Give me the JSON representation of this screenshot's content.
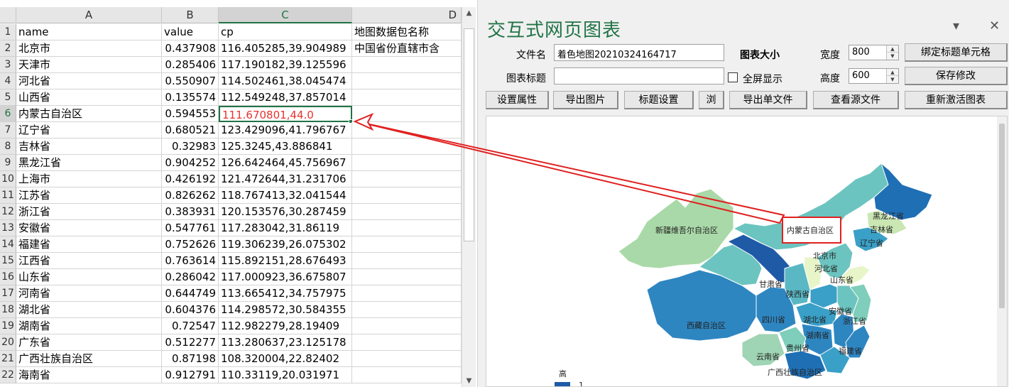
{
  "sheet": {
    "columns": [
      {
        "letter": "A"
      },
      {
        "letter": "B"
      },
      {
        "letter": "C"
      },
      {
        "letter": "D"
      }
    ],
    "rows": [
      {
        "num": "1",
        "name": "name",
        "value": "value",
        "cp": "cp",
        "d": "地图数据包名称"
      },
      {
        "num": "2",
        "name": "北京市",
        "value": "0.437908",
        "cp": "116.405285,39.904989",
        "d": "中国省份直辖市含"
      },
      {
        "num": "3",
        "name": "天津市",
        "value": "0.285406",
        "cp": "117.190182,39.125596",
        "d": ""
      },
      {
        "num": "4",
        "name": "河北省",
        "value": "0.550907",
        "cp": "114.502461,38.045474",
        "d": ""
      },
      {
        "num": "5",
        "name": "山西省",
        "value": "0.135574",
        "cp": "112.549248,37.857014",
        "d": ""
      },
      {
        "num": "6",
        "name": "内蒙古自治区",
        "value": "0.594553",
        "cp": "111.670801,44.0",
        "d": ""
      },
      {
        "num": "7",
        "name": "辽宁省",
        "value": "0.680521",
        "cp": "123.429096,41.796767",
        "d": ""
      },
      {
        "num": "8",
        "name": "吉林省",
        "value": "0.32983",
        "cp": "125.3245,43.886841",
        "d": ""
      },
      {
        "num": "9",
        "name": "黑龙江省",
        "value": "0.904252",
        "cp": "126.642464,45.756967",
        "d": ""
      },
      {
        "num": "10",
        "name": "上海市",
        "value": "0.426192",
        "cp": "121.472644,31.231706",
        "d": ""
      },
      {
        "num": "11",
        "name": "江苏省",
        "value": "0.826262",
        "cp": "118.767413,32.041544",
        "d": ""
      },
      {
        "num": "12",
        "name": "浙江省",
        "value": "0.383931",
        "cp": "120.153576,30.287459",
        "d": ""
      },
      {
        "num": "13",
        "name": "安徽省",
        "value": "0.547761",
        "cp": "117.283042,31.86119",
        "d": ""
      },
      {
        "num": "14",
        "name": "福建省",
        "value": "0.752626",
        "cp": "119.306239,26.075302",
        "d": ""
      },
      {
        "num": "15",
        "name": "江西省",
        "value": "0.763614",
        "cp": "115.892151,28.676493",
        "d": ""
      },
      {
        "num": "16",
        "name": "山东省",
        "value": "0.286042",
        "cp": "117.000923,36.675807",
        "d": ""
      },
      {
        "num": "17",
        "name": "河南省",
        "value": "0.644749",
        "cp": "113.665412,34.757975",
        "d": ""
      },
      {
        "num": "18",
        "name": "湖北省",
        "value": "0.604376",
        "cp": "114.298572,30.584355",
        "d": ""
      },
      {
        "num": "19",
        "name": "湖南省",
        "value": "0.72547",
        "cp": "112.982279,28.19409",
        "d": ""
      },
      {
        "num": "20",
        "name": "广东省",
        "value": "0.512277",
        "cp": "113.280637,23.125178",
        "d": ""
      },
      {
        "num": "21",
        "name": "广西壮族自治区",
        "value": "0.87198",
        "cp": "108.320004,22.82402",
        "d": ""
      },
      {
        "num": "22",
        "name": "海南省",
        "value": "0.912791",
        "cp": "110.33119,20.031971",
        "d": ""
      }
    ]
  },
  "panel": {
    "title": "交互式网页图表",
    "minimize_glyph": "▾",
    "close_glyph": "✕",
    "filename_label": "文件名",
    "filename_value": "着色地图20210324164717",
    "chart_size_label": "图表大小",
    "width_label": "宽度",
    "width_value": "800",
    "height_label": "高度",
    "height_value": "600",
    "bind_title_button": "绑定标题单元格",
    "chart_title_label": "图表标题",
    "chart_title_value": "",
    "fullscreen_label": "全屏显示",
    "save_button": "保存修改",
    "toolbar": [
      "设置属性",
      "导出图片",
      "标题设置",
      "浏",
      "导出单文件",
      "查看源文件",
      "重新激活图表"
    ]
  },
  "map": {
    "legend_high": "高",
    "legend_value": "1",
    "highlight_label": "内蒙古自治区",
    "regions": [
      {
        "name": "新疆维吾尔自治区",
        "color": "#a9d9a8"
      },
      {
        "name": "西藏自治区",
        "color": "#2e86c1"
      },
      {
        "name": "内蒙古自治区",
        "color": "#6cc4c0"
      },
      {
        "name": "甘肃省",
        "color": "#1f5aa6"
      },
      {
        "name": "黑龙江省",
        "color": "#1f6fb5"
      },
      {
        "name": "吉林省",
        "color": "#c9e6b3"
      },
      {
        "name": "辽宁省",
        "color": "#3aa0c7"
      },
      {
        "name": "北京市",
        "color": "#6cc4c0"
      },
      {
        "name": "河北省",
        "color": "#6cc4c0"
      },
      {
        "name": "山东省",
        "color": "#e8f5c8"
      },
      {
        "name": "陕西省",
        "color": "#5ab8c4"
      },
      {
        "name": "四川省",
        "color": "#2e86c1"
      },
      {
        "name": "安徽省",
        "color": "#6cc4c0"
      },
      {
        "name": "湖北省",
        "color": "#3aa0c7"
      },
      {
        "name": "浙江省",
        "color": "#7fcdbb"
      },
      {
        "name": "湖南省",
        "color": "#2e86c1"
      },
      {
        "name": "贵州省",
        "color": "#7fcdbb"
      },
      {
        "name": "福建省",
        "color": "#2e86c1"
      },
      {
        "name": "云南省",
        "color": "#9fd4b4"
      },
      {
        "name": "广西壮族自治区",
        "color": "#1f6fb5"
      }
    ]
  },
  "colors": {
    "excel_green": "#217346",
    "annotation_red": "#e02020",
    "selected_text_red": "#e8312f"
  }
}
